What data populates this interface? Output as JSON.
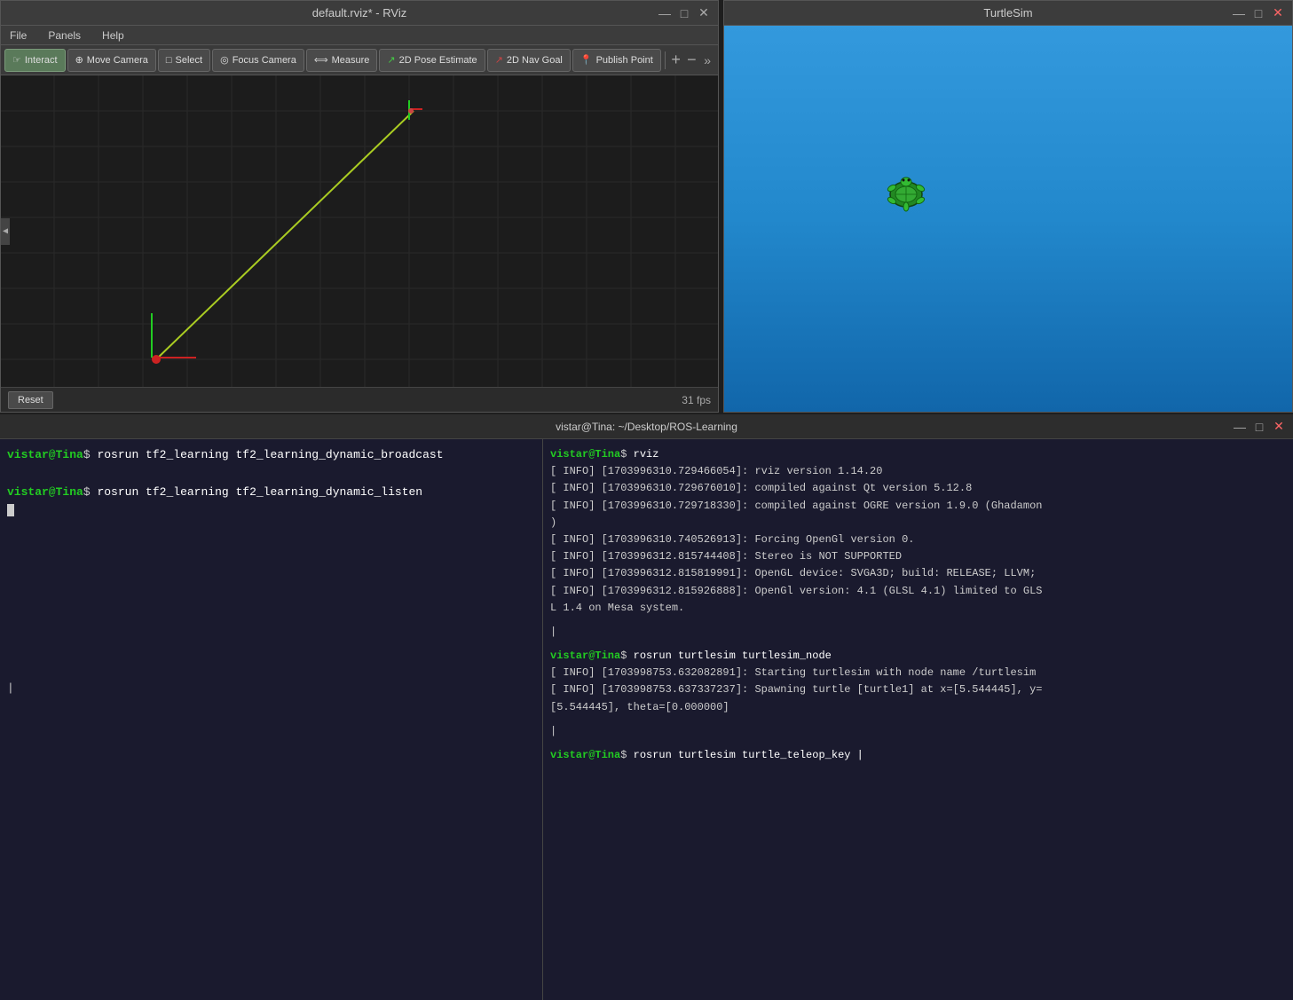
{
  "rviz": {
    "title": "default.rviz* - RViz",
    "menu": {
      "file": "File",
      "panels": "Panels",
      "help": "Help"
    },
    "toolbar": {
      "interact": "Interact",
      "move_camera": "Move Camera",
      "select": "Select",
      "focus_camera": "Focus Camera",
      "measure": "Measure",
      "pose_estimate": "2D Pose Estimate",
      "nav_goal": "2D Nav Goal",
      "publish_point": "Publish Point"
    },
    "statusbar": {
      "reset": "Reset",
      "fps": "31 fps"
    }
  },
  "turtlesim": {
    "title": "TurtleSim"
  },
  "terminal": {
    "title": "vistar@Tina: ~/Desktop/ROS-Learning",
    "left": {
      "prompt1": "vistar@Tina",
      "cmd1": "rosrun tf2_learning tf2_learning_dynamic_broadcast",
      "prompt2": "vistar@Tina",
      "cmd2": "rosrun tf2_learning tf2_learning_dynamic_listen"
    },
    "right": {
      "prompt1": "vistar@Tina",
      "cmd1": "rviz",
      "info_lines": [
        "[ INFO] [1703996310.729466054]: rviz version 1.14.20",
        "[ INFO] [1703996310.729676010]: compiled against Qt version 5.12.8",
        "[ INFO] [1703996310.729718330]: compiled against OGRE version 1.9.0 (Ghadamon)",
        ")",
        "[ INFO] [1703996310.740526913]: Forcing OpenGl version 0.",
        "[ INFO] [1703996312.815744408]: Stereo is NOT SUPPORTED",
        "[ INFO] [1703996312.815819991]: OpenGL device: SVGA3D; build: RELEASE;  LLVM;",
        "[ INFO] [1703996312.815926888]: OpenGl version: 4.1 (GLSL 4.1) limited to GLS",
        "L 1.4 on Mesa system."
      ],
      "prompt2": "vistar@Tina",
      "cmd2": "rosrun turtlesim turtlesim_node",
      "info_lines2": [
        "[ INFO] [1703998753.632082891]: Starting turtlesim with node name /turtlesim",
        "[ INFO] [1703998753.637337237]: Spawning turtle [turtle1] at x=[5.544445], y=",
        "[5.544445], theta=[0.000000]"
      ],
      "prompt3": "vistar@Tina",
      "cmd3": "rosrun turtlesim turtle_teleop_key |"
    },
    "window_controls": {
      "minimize": "—",
      "maximize": "□",
      "close": "✕"
    }
  }
}
